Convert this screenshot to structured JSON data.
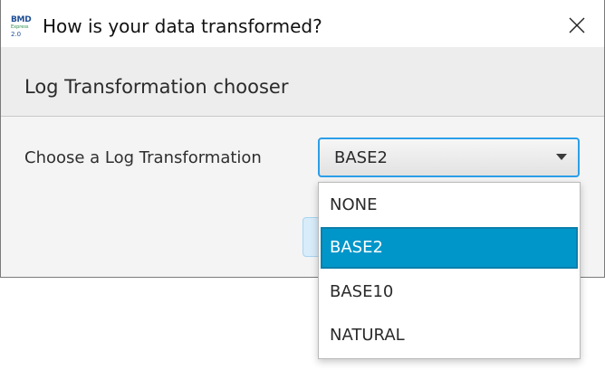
{
  "window": {
    "title": "How is your data transformed?",
    "logo": {
      "line1": "BMD",
      "line2": "Express",
      "line3": "2.0"
    }
  },
  "dialog": {
    "header": "Log Transformation chooser",
    "field_label": "Choose a Log Transformation"
  },
  "combo": {
    "selected_value": "BASE2",
    "expanded": true,
    "options": [
      "NONE",
      "BASE2",
      "BASE10",
      "NATURAL"
    ],
    "highlighted_option": "BASE2"
  },
  "icons": {
    "close": "close-icon",
    "dropdown": "chevron-down-icon"
  },
  "colors": {
    "accent": "#2b9ee8",
    "selection": "#0096c9"
  }
}
